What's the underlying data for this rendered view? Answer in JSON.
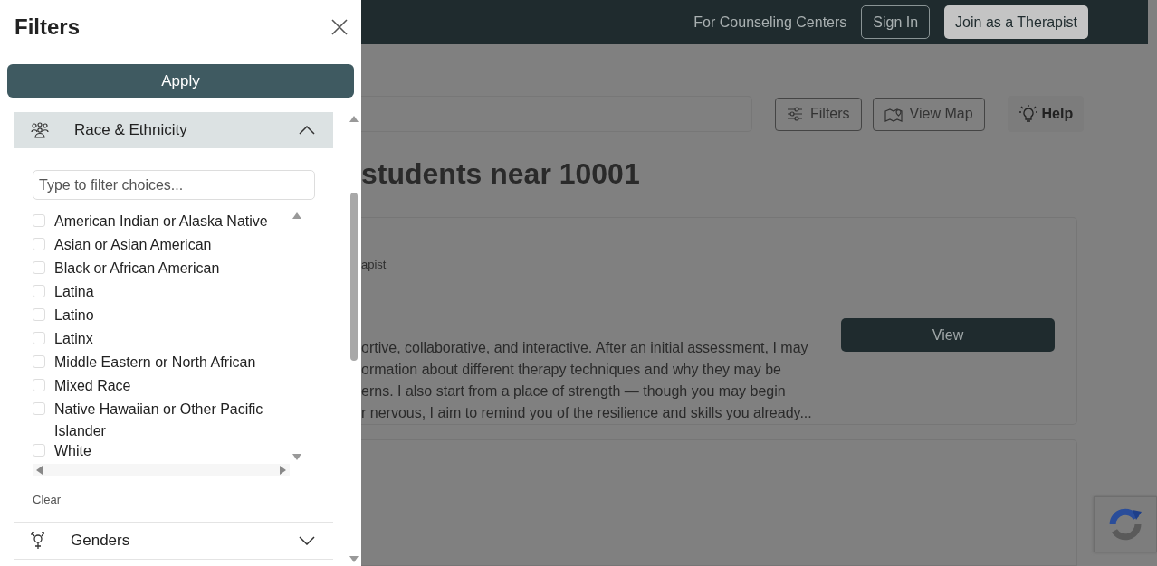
{
  "filters_panel": {
    "title": "Filters",
    "apply": "Apply",
    "sections": [
      {
        "label": "Race & Ethnicity",
        "expanded": true,
        "search": {
          "placeholder": "Type to filter choices..."
        },
        "options": [
          {
            "label": "American Indian or Alaska Native",
            "checked": false
          },
          {
            "label": "Asian or Asian American",
            "checked": false
          },
          {
            "label": "Black or African American",
            "checked": false
          },
          {
            "label": "Latina",
            "checked": false
          },
          {
            "label": "Latino",
            "checked": false
          },
          {
            "label": "Latinx",
            "checked": false
          },
          {
            "label": "Middle Eastern or North African",
            "checked": false
          },
          {
            "label": "Mixed Race",
            "checked": false
          },
          {
            "label": "Native Hawaiian or Other Pacific Islander",
            "checked": false
          },
          {
            "label": "White",
            "checked": false
          }
        ],
        "clear": "Clear"
      },
      {
        "label": "Genders",
        "expanded": false
      }
    ]
  },
  "page": {
    "nav": {
      "link": "For Counseling Centers",
      "sign_in": "Sign In",
      "join": "Join as a Therapist"
    },
    "toolbar": [
      {
        "label": "Filters",
        "kind": "outlined"
      },
      {
        "label": "View Map",
        "kind": "outlined"
      },
      {
        "label": "Help",
        "kind": "plain"
      }
    ],
    "heading": "students near 10001",
    "result": {
      "subtitle": "apist",
      "description_lines": [
        "ortive, collaborative, and interactive. After an initial assessment, I may",
        "ormation about different therapy techniques and why they may be",
        "erns. I also start from a place of strength — though you may begin",
        "r nervous, I aim to remind you of the resilience and skills you already..."
      ],
      "button": "View"
    }
  }
}
